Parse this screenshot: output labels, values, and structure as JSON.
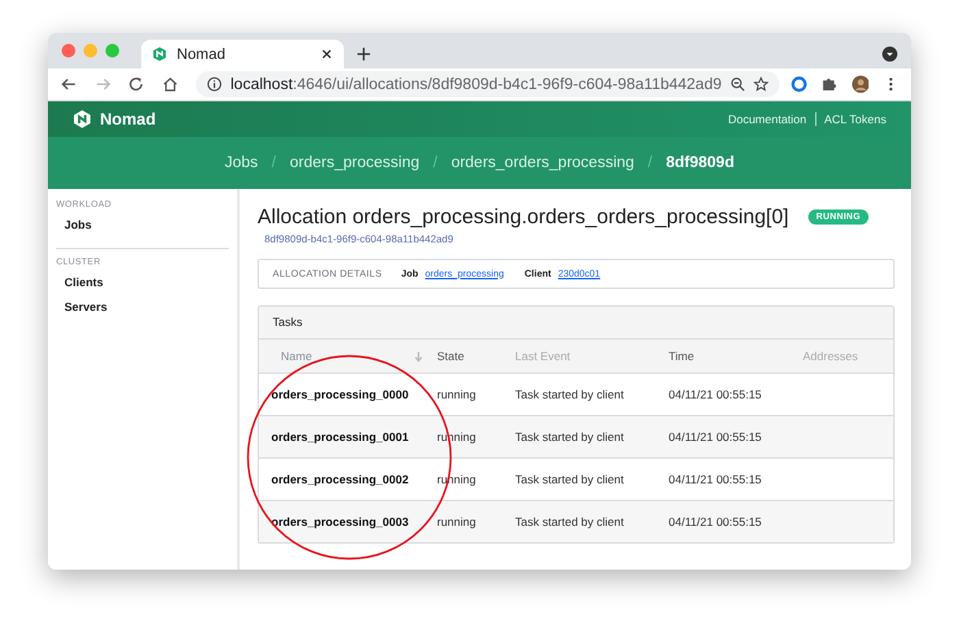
{
  "browser": {
    "tab_title": "Nomad",
    "url": "**localhost**:4646/ui/allocations/8df9809d-b4c1-96f9-c604-98a11b442ad9"
  },
  "header": {
    "brand": "Nomad",
    "links": [
      "Documentation",
      "ACL Tokens"
    ]
  },
  "breadcrumbs": {
    "separator": "/",
    "items": [
      {
        "label": "Jobs",
        "current": false
      },
      {
        "label": "orders_processing",
        "current": false
      },
      {
        "label": "orders_orders_processing",
        "current": false
      },
      {
        "label": "8df9809d",
        "current": true
      }
    ]
  },
  "sidebar": [
    {
      "heading": "WORKLOAD",
      "items": [
        "Jobs"
      ]
    },
    {
      "heading": "CLUSTER",
      "items": [
        "Clients",
        "Servers"
      ]
    }
  ],
  "allocation": {
    "title": "Allocation orders_processing.orders_orders_processing[0]",
    "status": "RUNNING",
    "id": "8df9809d-b4c1-96f9-c604-98a11b442ad9"
  },
  "details": {
    "label": "ALLOCATION DETAILS",
    "fields": [
      {
        "label": "Job",
        "value": "orders_processing"
      },
      {
        "label": "Client",
        "value": "230d0c01"
      }
    ]
  },
  "tasks": {
    "title": "Tasks",
    "columns": [
      {
        "label": "Name",
        "sorted": true
      },
      {
        "label": "State",
        "sorted": false
      },
      {
        "label": "Last Event",
        "sorted": false
      },
      {
        "label": "Time",
        "sorted": false
      },
      {
        "label": "Addresses",
        "sorted": false
      }
    ],
    "rows": [
      {
        "name": "orders_processing_0000",
        "state": "running",
        "last_event": "Task started by client",
        "time": "04/11/21 00:55:15"
      },
      {
        "name": "orders_processing_0001",
        "state": "running",
        "last_event": "Task started by client",
        "time": "04/11/21 00:55:15"
      },
      {
        "name": "orders_processing_0002",
        "state": "running",
        "last_event": "Task started by client",
        "time": "04/11/21 00:55:15"
      },
      {
        "name": "orders_processing_0003",
        "state": "running",
        "last_event": "Task started by client",
        "time": "04/11/21 00:55:15"
      }
    ]
  }
}
